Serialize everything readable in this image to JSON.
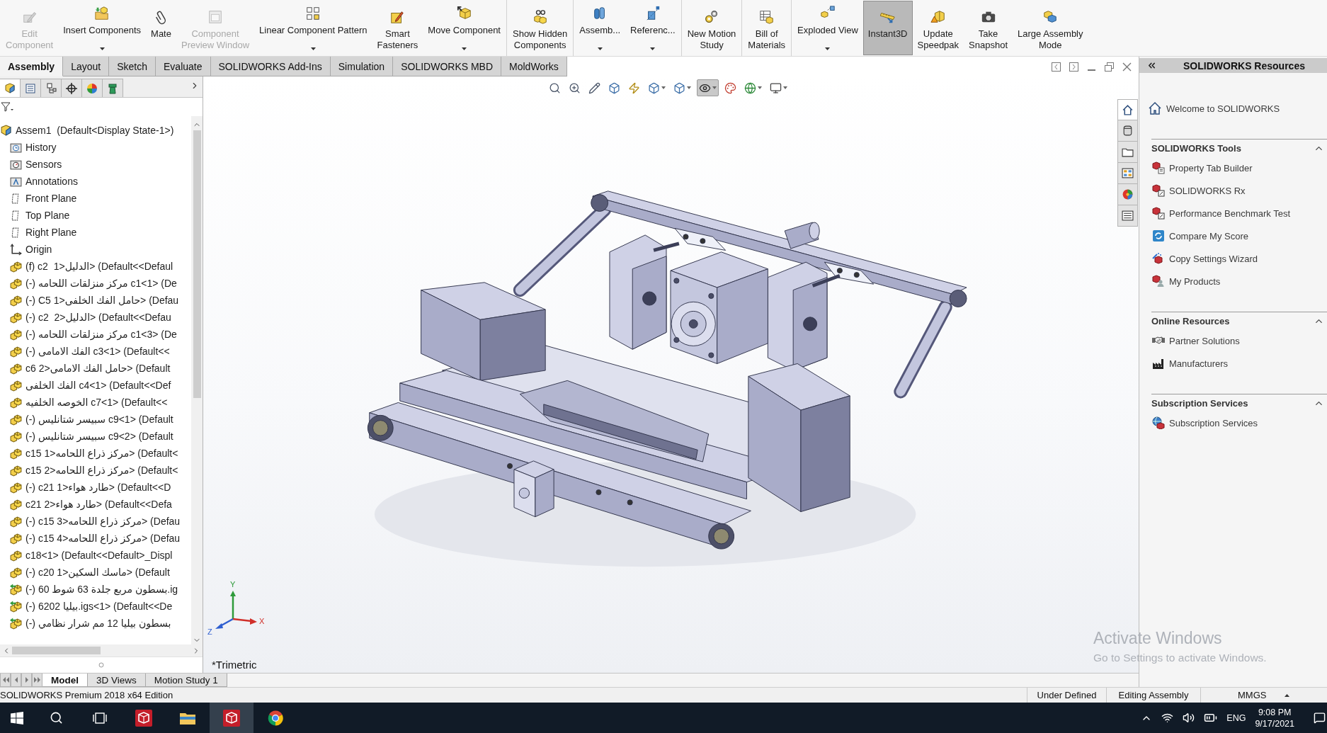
{
  "command_manager": {
    "groups": [
      {
        "items": [
          {
            "label": "Edit\nComponent",
            "disabled": true,
            "selected": false,
            "dropdown": false
          },
          {
            "label": "Insert Components",
            "disabled": false,
            "selected": false,
            "dropdown": true
          },
          {
            "label": "Mate",
            "disabled": false,
            "selected": false,
            "dropdown": false
          },
          {
            "label": "Component\nPreview Window",
            "disabled": true,
            "selected": false,
            "dropdown": false
          },
          {
            "label": "Linear Component Pattern",
            "disabled": false,
            "selected": false,
            "dropdown": true
          },
          {
            "label": "Smart\nFasteners",
            "disabled": false,
            "selected": false,
            "dropdown": false
          },
          {
            "label": "Move Component",
            "disabled": false,
            "selected": false,
            "dropdown": true
          }
        ]
      },
      {
        "items": [
          {
            "label": "Show Hidden\nComponents",
            "disabled": false,
            "selected": false,
            "dropdown": false
          }
        ]
      },
      {
        "items": [
          {
            "label": "Assemb...",
            "disabled": false,
            "selected": false,
            "dropdown": true
          },
          {
            "label": "Referenc...",
            "disabled": false,
            "selected": false,
            "dropdown": true
          }
        ]
      },
      {
        "items": [
          {
            "label": "New Motion\nStudy",
            "disabled": false,
            "selected": false,
            "dropdown": false
          }
        ]
      },
      {
        "items": [
          {
            "label": "Bill of\nMaterials",
            "disabled": false,
            "selected": false,
            "dropdown": false
          }
        ]
      },
      {
        "items": [
          {
            "label": "Exploded View",
            "disabled": false,
            "selected": false,
            "dropdown": true
          },
          {
            "label": "Instant3D",
            "disabled": false,
            "selected": true,
            "dropdown": false
          },
          {
            "label": "Update\nSpeedpak",
            "disabled": false,
            "selected": false,
            "dropdown": false
          },
          {
            "label": "Take\nSnapshot",
            "disabled": false,
            "selected": false,
            "dropdown": false
          },
          {
            "label": "Large Assembly\nMode",
            "disabled": false,
            "selected": false,
            "dropdown": false
          }
        ]
      }
    ]
  },
  "command_tabs": [
    {
      "label": "Assembly",
      "selected": true
    },
    {
      "label": "Layout",
      "selected": false
    },
    {
      "label": "Sketch",
      "selected": false
    },
    {
      "label": "Evaluate",
      "selected": false
    },
    {
      "label": "SOLIDWORKS Add-Ins",
      "selected": false
    },
    {
      "label": "Simulation",
      "selected": false
    },
    {
      "label": "SOLIDWORKS MBD",
      "selected": false
    },
    {
      "label": "MoldWorks",
      "selected": false
    }
  ],
  "feature_manager": {
    "panel_tabs": [
      {
        "selected": true
      },
      {
        "selected": false
      },
      {
        "selected": false
      },
      {
        "selected": false
      },
      {
        "selected": false
      },
      {
        "selected": false
      }
    ],
    "tree": {
      "label": "Assem1  (Default<Display State-1>)",
      "kind": "assembly",
      "children": [
        {
          "label": "History",
          "kind": "history"
        },
        {
          "label": "Sensors",
          "kind": "sensors"
        },
        {
          "label": "Annotations",
          "kind": "annotations"
        },
        {
          "label": "Front Plane",
          "kind": "plane"
        },
        {
          "label": "Top Plane",
          "kind": "plane"
        },
        {
          "label": "Right Plane",
          "kind": "plane"
        },
        {
          "label": "Origin",
          "kind": "origin"
        },
        {
          "label": "(f) c2  الدليل<1> (Default<<Defaul",
          "kind": "part"
        },
        {
          "label": "(-) مركز منزلقات اللحامه c1<1> (De",
          "kind": "part"
        },
        {
          "label": "(-) C5 حامل الفك الخلفى<1> (Defau",
          "kind": "part"
        },
        {
          "label": "(-) c2  الدليل<2> (Default<<Defau",
          "kind": "part"
        },
        {
          "label": "(-) مركز منزلقات اللحامه c1<3> (De",
          "kind": "part"
        },
        {
          "label": "(-) الفك الامامى c3<1> (Default<<",
          "kind": "part"
        },
        {
          "label": "c6 حامل الفك الامامى<2> (Default",
          "kind": "part"
        },
        {
          "label": "الفك الخلفى c4<1> (Default<<Def",
          "kind": "part"
        },
        {
          "label": "الخوصه الخلفيه c7<1> (Default<<",
          "kind": "part"
        },
        {
          "label": "(-) سبيسر شتانليس c9<1> (Default",
          "kind": "part"
        },
        {
          "label": "(-) سبيسر شتانليس c9<2> (Default",
          "kind": "part"
        },
        {
          "label": "c15 مركز ذراع اللحامه<1> (Default<",
          "kind": "part"
        },
        {
          "label": "c15 مركز ذراع اللحامه<2> (Default<",
          "kind": "part"
        },
        {
          "label": "(-) c21 طارد هواء<1> (Default<<D",
          "kind": "part"
        },
        {
          "label": "c21 طارد هواء<2> (Default<<Defa",
          "kind": "part"
        },
        {
          "label": "(-) c15 مركز ذراع اللحامه<3> (Defau",
          "kind": "part"
        },
        {
          "label": "(-) c15 مركز ذراع اللحامه<4> (Defau",
          "kind": "part"
        },
        {
          "label": "c18<1> (Default<<Default>_Displ",
          "kind": "part"
        },
        {
          "label": "(-) c20 ماسك السكين<1> (Default",
          "kind": "part"
        },
        {
          "label": "(-) بسطون مربع جلدة 63 شوط 60.ig",
          "kind": "imported_part"
        },
        {
          "label": "(-) بيليا 6202.igs<1> (Default<<De",
          "kind": "imported_part"
        },
        {
          "label": "(-) بسطون بيليا 12 مم شرار نظامي",
          "kind": "imported_part"
        }
      ]
    }
  },
  "view_toolbar": [
    {
      "pressed": false,
      "dropdown": false
    },
    {
      "pressed": false,
      "dropdown": false
    },
    {
      "pressed": false,
      "dropdown": false
    },
    {
      "pressed": false,
      "dropdown": false
    },
    {
      "pressed": false,
      "dropdown": false
    },
    {
      "pressed": false,
      "dropdown": true
    },
    {
      "pressed": false,
      "dropdown": true
    },
    {
      "pressed": true,
      "dropdown": true
    },
    {
      "pressed": false,
      "dropdown": false
    },
    {
      "pressed": false,
      "dropdown": true
    },
    {
      "pressed": false,
      "dropdown": true
    }
  ],
  "graphics": {
    "view_name": "*Trimetric",
    "triad": {
      "x_label": "X",
      "y_label": "Y",
      "z_label": "Z"
    }
  },
  "bottom_tabs": [
    {
      "label": "Model",
      "selected": true
    },
    {
      "label": "3D Views",
      "selected": false
    },
    {
      "label": "Motion Study 1",
      "selected": false
    }
  ],
  "task_pane": {
    "tabs": [
      {
        "selected": true
      },
      {
        "selected": false
      },
      {
        "selected": false
      },
      {
        "selected": false
      },
      {
        "selected": false
      },
      {
        "selected": false
      }
    ],
    "title": "SOLIDWORKS Resources",
    "welcome": "Welcome to SOLIDWORKS",
    "sections": [
      {
        "title": "SOLIDWORKS Tools",
        "expanded": true,
        "items": [
          "Property Tab Builder",
          "SOLIDWORKS Rx",
          "Performance Benchmark Test",
          "Compare My Score",
          "Copy Settings Wizard",
          "My Products"
        ]
      },
      {
        "title": "Online Resources",
        "expanded": true,
        "items": [
          "Partner Solutions",
          "Manufacturers"
        ]
      },
      {
        "title": "Subscription Services",
        "expanded": true,
        "items": [
          "Subscription Services"
        ]
      }
    ]
  },
  "activation_notice": {
    "title": "Activate Windows",
    "message": "Go to Settings to activate Windows."
  },
  "status_bar": {
    "product": "SOLIDWORKS Premium 2018 x64 Edition",
    "state": "Under Defined",
    "mode": "Editing Assembly",
    "units": "MMGS"
  },
  "taskbar": {
    "apps": [
      {
        "kind": "cad",
        "active": false
      },
      {
        "kind": "files",
        "active": false
      },
      {
        "kind": "cad",
        "active": true
      },
      {
        "kind": "browser",
        "active": false
      }
    ],
    "language": "ENG",
    "time": "9:08 PM",
    "date": "9/17/2021"
  }
}
